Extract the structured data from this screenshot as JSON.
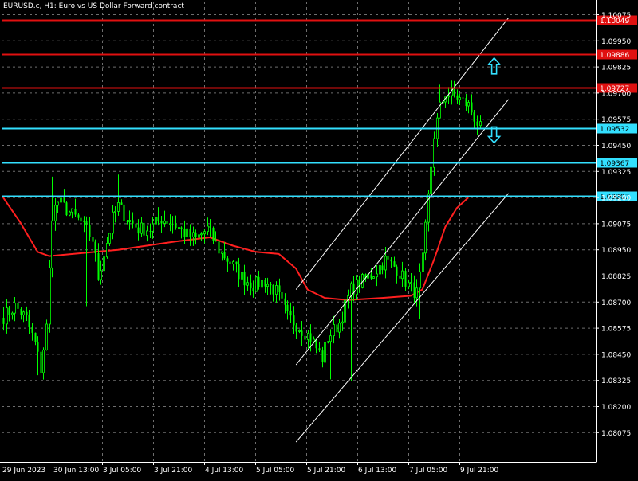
{
  "chart_data": {
    "type": "candlestick",
    "title": "EURUSD.c, H1:  Euro vs US Dollar Forward contract",
    "colors": {
      "background": "#000000",
      "grid": "#6e6e6e",
      "axis_text": "#ffffff",
      "candle": "#00ff00",
      "moving_average": "#ff1f1f",
      "resistance": "#e01010",
      "support": "#33e0ff",
      "channel": "#ffffff",
      "arrow": "#33e0ff"
    },
    "grid": true,
    "y_axis": {
      "position": "right",
      "range": [
        1.08,
        1.1015
      ],
      "tick_labels": [
        "1.10075",
        "1.09950",
        "1.09825",
        "1.09700",
        "1.09575",
        "1.09450",
        "1.09325",
        "1.09200",
        "1.09075",
        "1.08950",
        "1.08825",
        "1.08700",
        "1.08575",
        "1.08450",
        "1.08325",
        "1.08200",
        "1.08075"
      ]
    },
    "x_axis": {
      "tick_labels": [
        "29 Jun 2023",
        "30 Jun 13:00",
        "3 Jul 05:00",
        "3 Jul 21:00",
        "4 Jul 13:00",
        "5 Jul 05:00",
        "5 Jul 21:00",
        "6 Jul 13:00",
        "7 Jul 05:00",
        "9 Jul 21:00"
      ]
    },
    "horizontal_levels": [
      {
        "price": 1.10049,
        "label": "1.10049",
        "kind": "resistance"
      },
      {
        "price": 1.09886,
        "label": "1.09886",
        "kind": "resistance"
      },
      {
        "price": 1.09727,
        "label": "1.09727",
        "kind": "resistance"
      },
      {
        "price": 1.09532,
        "label": "1.09532",
        "kind": "support"
      },
      {
        "price": 1.09367,
        "label": "1.09367",
        "kind": "support"
      },
      {
        "price": 1.09207,
        "label": "1.09207",
        "kind": "support"
      }
    ],
    "series": [
      {
        "name": "EURUSD.c",
        "type": "candlestick",
        "close_anchors": [
          [
            0,
            1.0863
          ],
          [
            4,
            1.0868
          ],
          [
            8,
            1.0862
          ],
          [
            11,
            1.085
          ],
          [
            13,
            1.0838
          ],
          [
            15,
            1.0858
          ],
          [
            17,
            1.0912
          ],
          [
            19,
            1.0918
          ],
          [
            23,
            1.0913
          ],
          [
            27,
            1.0908
          ],
          [
            31,
            1.09
          ],
          [
            33,
            1.0882
          ],
          [
            35,
            1.0893
          ],
          [
            38,
            1.091
          ],
          [
            40,
            1.0916
          ],
          [
            43,
            1.091
          ],
          [
            47,
            1.0905
          ],
          [
            51,
            1.0905
          ],
          [
            55,
            1.091
          ],
          [
            59,
            1.0908
          ],
          [
            63,
            1.0903
          ],
          [
            67,
            1.09
          ],
          [
            71,
            1.0905
          ],
          [
            75,
            1.0895
          ],
          [
            79,
            1.0889
          ],
          [
            83,
            1.0882
          ],
          [
            87,
            1.0878
          ],
          [
            91,
            1.088
          ],
          [
            95,
            1.0875
          ],
          [
            99,
            1.0863
          ],
          [
            103,
            1.0858
          ],
          [
            107,
            1.0853
          ],
          [
            111,
            1.0843
          ],
          [
            113,
            1.0853
          ],
          [
            117,
            1.086
          ],
          [
            121,
            1.0876
          ],
          [
            125,
            1.088
          ],
          [
            129,
            1.0884
          ],
          [
            133,
            1.089
          ],
          [
            137,
            1.0886
          ],
          [
            141,
            1.0878
          ],
          [
            144,
            1.0874
          ],
          [
            146,
            1.089
          ],
          [
            148,
            1.092
          ],
          [
            150,
            1.095
          ],
          [
            152,
            1.0963
          ],
          [
            154,
            1.097
          ],
          [
            158,
            1.0968
          ],
          [
            162,
            1.0964
          ],
          [
            166,
            1.0953
          ]
        ],
        "wick_spikes": [
          {
            "i": 12,
            "low": 1.0835
          },
          {
            "i": 17,
            "high": 1.093
          },
          {
            "i": 29,
            "low": 1.0868
          },
          {
            "i": 40,
            "high": 1.0931
          },
          {
            "i": 114,
            "low": 1.0833
          },
          {
            "i": 121,
            "low": 1.0832
          },
          {
            "i": 145,
            "low": 1.0862
          },
          {
            "i": 152,
            "high": 1.0974
          }
        ]
      },
      {
        "name": "moving-average",
        "type": "line",
        "points": [
          [
            0,
            1.092
          ],
          [
            6,
            1.0908
          ],
          [
            12,
            1.0894
          ],
          [
            16,
            1.0892
          ],
          [
            40,
            1.0895
          ],
          [
            60,
            1.0899
          ],
          [
            72,
            1.0901
          ],
          [
            80,
            1.0897
          ],
          [
            88,
            1.0894
          ],
          [
            96,
            1.0893
          ],
          [
            102,
            1.0886
          ],
          [
            106,
            1.0876
          ],
          [
            112,
            1.0872
          ],
          [
            120,
            1.0871
          ],
          [
            132,
            1.0872
          ],
          [
            142,
            1.0873
          ],
          [
            146,
            1.0876
          ],
          [
            150,
            1.089
          ],
          [
            154,
            1.0906
          ],
          [
            158,
            1.0915
          ],
          [
            162,
            1.092
          ]
        ]
      }
    ],
    "channel_lines": [
      {
        "from": [
          102,
          1.0876
        ],
        "to": [
          176,
          1.1006
        ]
      },
      {
        "from": [
          102,
          1.084
        ],
        "to": [
          176,
          1.0967
        ]
      },
      {
        "from": [
          102,
          1.0803
        ],
        "to": [
          176,
          1.0922
        ]
      }
    ],
    "arrows": [
      {
        "direction": "up",
        "at": [
          171,
          1.0983
        ]
      },
      {
        "direction": "down",
        "at": [
          171,
          1.095
        ]
      }
    ]
  }
}
